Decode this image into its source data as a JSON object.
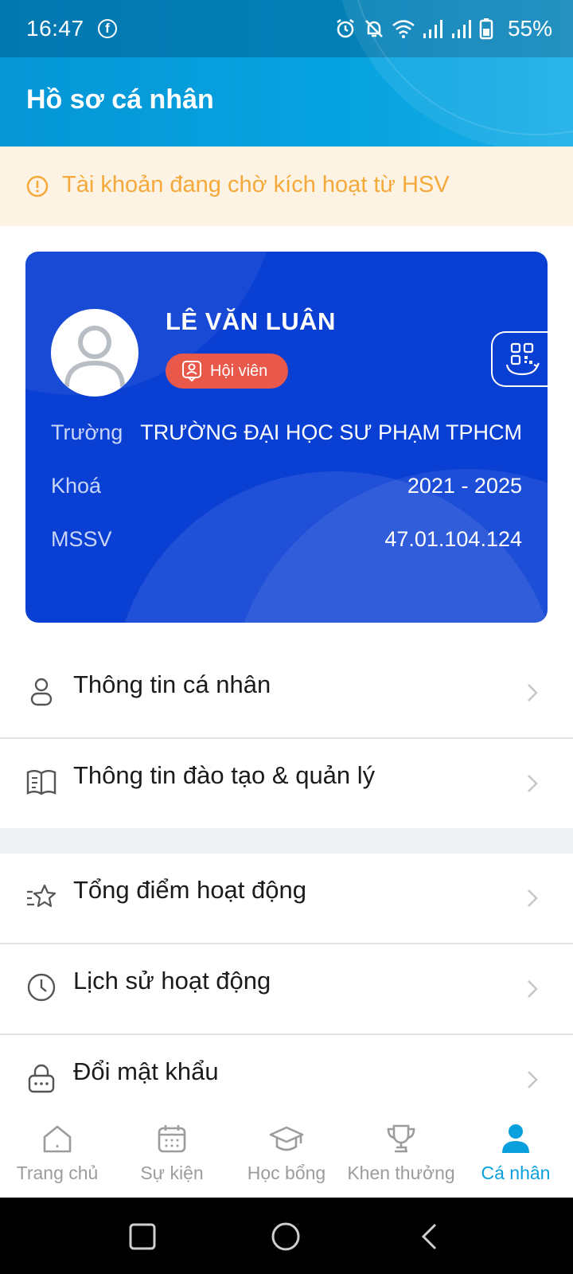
{
  "status_bar": {
    "time": "16:47",
    "battery": "55%",
    "facebook_glyph": "f"
  },
  "header": {
    "title": "Hồ sơ cá nhân"
  },
  "banner": {
    "text": "Tài khoản đang chờ kích hoạt từ HSV",
    "color": "#f5a93a"
  },
  "card": {
    "name": "LÊ VĂN LUÂN",
    "badge": "Hội viên",
    "rows": [
      {
        "label": "Trường",
        "value": "TRƯỜNG ĐẠI HỌC SƯ PHẠM TPHCM"
      },
      {
        "label": "Khoá",
        "value": "2021 - 2025"
      },
      {
        "label": "MSSV",
        "value": "47.01.104.124"
      }
    ],
    "color": "#0a3fd4"
  },
  "menu": [
    {
      "label": "Thông tin cá nhân",
      "icon": "user-icon"
    },
    {
      "label": "Thông tin đào tạo & quản lý",
      "icon": "book-icon"
    },
    {
      "label": "Tổng điểm hoạt động",
      "icon": "star-list-icon"
    },
    {
      "label": "Lịch sử hoạt động",
      "icon": "clock-icon"
    },
    {
      "label": "Đổi mật khẩu",
      "icon": "lock-icon"
    }
  ],
  "bottom_nav": [
    {
      "label": "Trang chủ",
      "icon": "home-icon",
      "active": false
    },
    {
      "label": "Sự kiện",
      "icon": "calendar-icon",
      "active": false
    },
    {
      "label": "Học bổng",
      "icon": "graduation-cap-icon",
      "active": false
    },
    {
      "label": "Khen thưởng",
      "icon": "trophy-icon",
      "active": false
    },
    {
      "label": "Cá nhân",
      "icon": "person-icon",
      "active": true
    }
  ],
  "accent_color": "#0aa0de"
}
